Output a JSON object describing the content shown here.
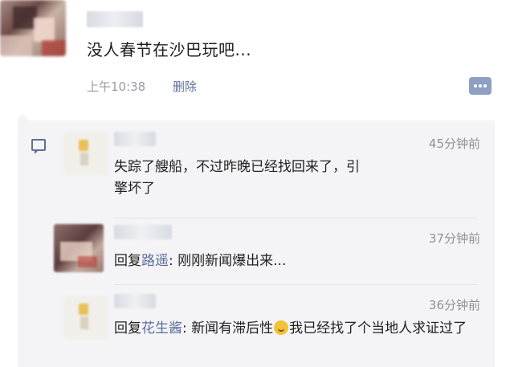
{
  "post": {
    "text": "没人春节在沙巴玩吧...",
    "time": "上午10:38",
    "delete_label": "删除"
  },
  "comments": [
    {
      "time": "45分钟前",
      "text": "失踪了艘船，不过昨晚已经找回来了，引擎坏了"
    },
    {
      "time": "37分钟前",
      "reply_prefix": "回复",
      "reply_to": "路遥",
      "separator": ": ",
      "text": "刚刚新闻爆出来..."
    },
    {
      "time": "36分钟前",
      "reply_prefix": "回复",
      "reply_to": "花生酱",
      "separator": ": ",
      "text_before_emoji": "新闻有滞后性",
      "text_after_emoji": "我已经找了个当地人求证过了"
    }
  ],
  "icons": {
    "more": "more-dots-icon",
    "comment": "comment-icon",
    "emoji": "thinking-emoji-icon"
  },
  "colors": {
    "link": "#5b6e9e",
    "comment_bg": "#f4f4f6",
    "more_button": "#8ea0c2"
  }
}
